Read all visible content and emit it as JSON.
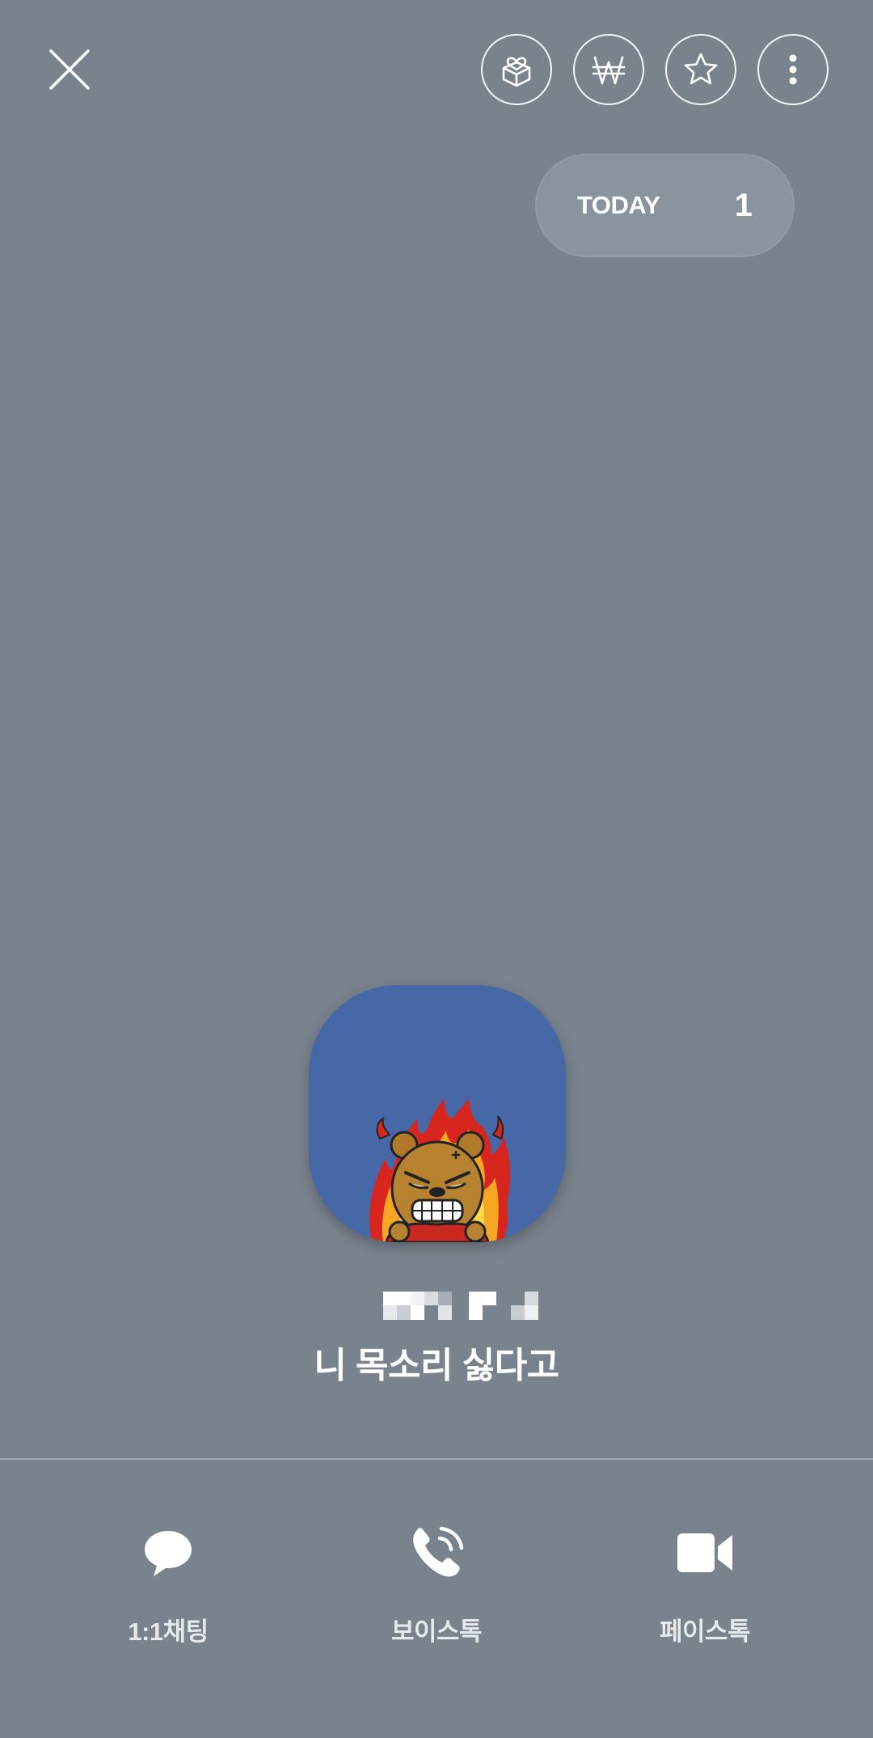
{
  "header": {
    "close_icon": "close-icon",
    "actions": [
      {
        "name": "gift-icon"
      },
      {
        "name": "won-currency-icon"
      },
      {
        "name": "star-icon"
      },
      {
        "name": "more-vertical-icon"
      }
    ]
  },
  "today": {
    "label": "TODAY",
    "count": "1"
  },
  "profile": {
    "avatar_icon": "angry-bear-character",
    "name_redacted": true,
    "status_message": "니 목소리 싫다고",
    "avatar_bg": "#4768a6"
  },
  "bottom_actions": [
    {
      "icon": "chat-bubble-icon",
      "label": "1:1채팅"
    },
    {
      "icon": "voice-call-icon",
      "label": "보이스톡"
    },
    {
      "icon": "video-camera-icon",
      "label": "페이스톡"
    }
  ],
  "colors": {
    "background": "#79838e",
    "pill": "#89949e"
  }
}
